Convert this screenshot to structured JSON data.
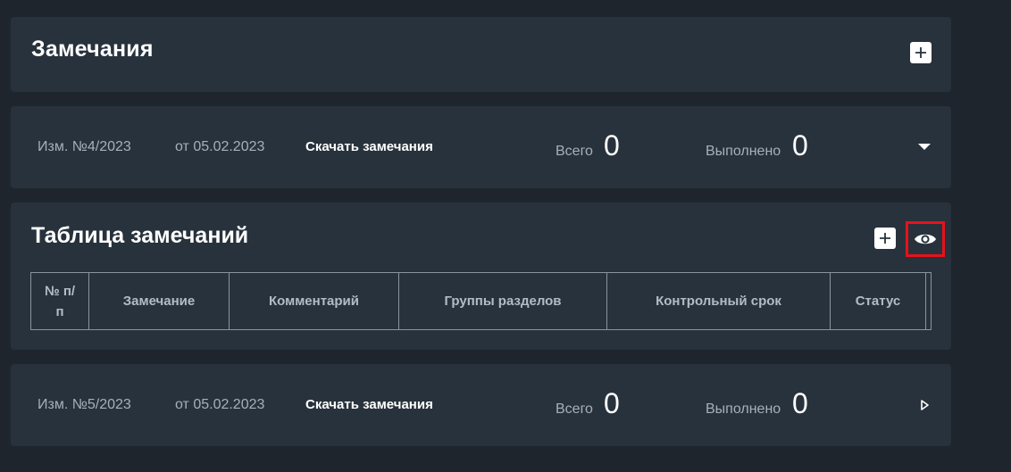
{
  "header": {
    "title": "Замечания",
    "add_icon": "plus-icon"
  },
  "revisions": [
    {
      "code": "Изм. №4/2023",
      "date": "от 05.02.2023",
      "download_label": "Скачать замечания",
      "total_label": "Всего",
      "total_value": "0",
      "done_label": "Выполнено",
      "done_value": "0",
      "toggle_icon": "caret-down-icon"
    },
    {
      "code": "Изм. №5/2023",
      "date": "от 05.02.2023",
      "download_label": "Скачать замечания",
      "total_label": "Всего",
      "total_value": "0",
      "done_label": "Выполнено",
      "done_value": "0",
      "toggle_icon": "caret-right-icon"
    }
  ],
  "remarks_table": {
    "title": "Таблица замечаний",
    "add_icon": "plus-icon",
    "view_icon": "eye-icon",
    "highlight_color": "#e8111a",
    "columns": [
      "№ п/п",
      "Замечание",
      "Комментарий",
      "Группы разделов",
      "Контрольный срок",
      "Статус",
      ""
    ]
  },
  "colors": {
    "background": "#1e252c",
    "card": "#28323c",
    "text_primary": "#ffffff",
    "text_secondary": "#a6b0ba"
  }
}
